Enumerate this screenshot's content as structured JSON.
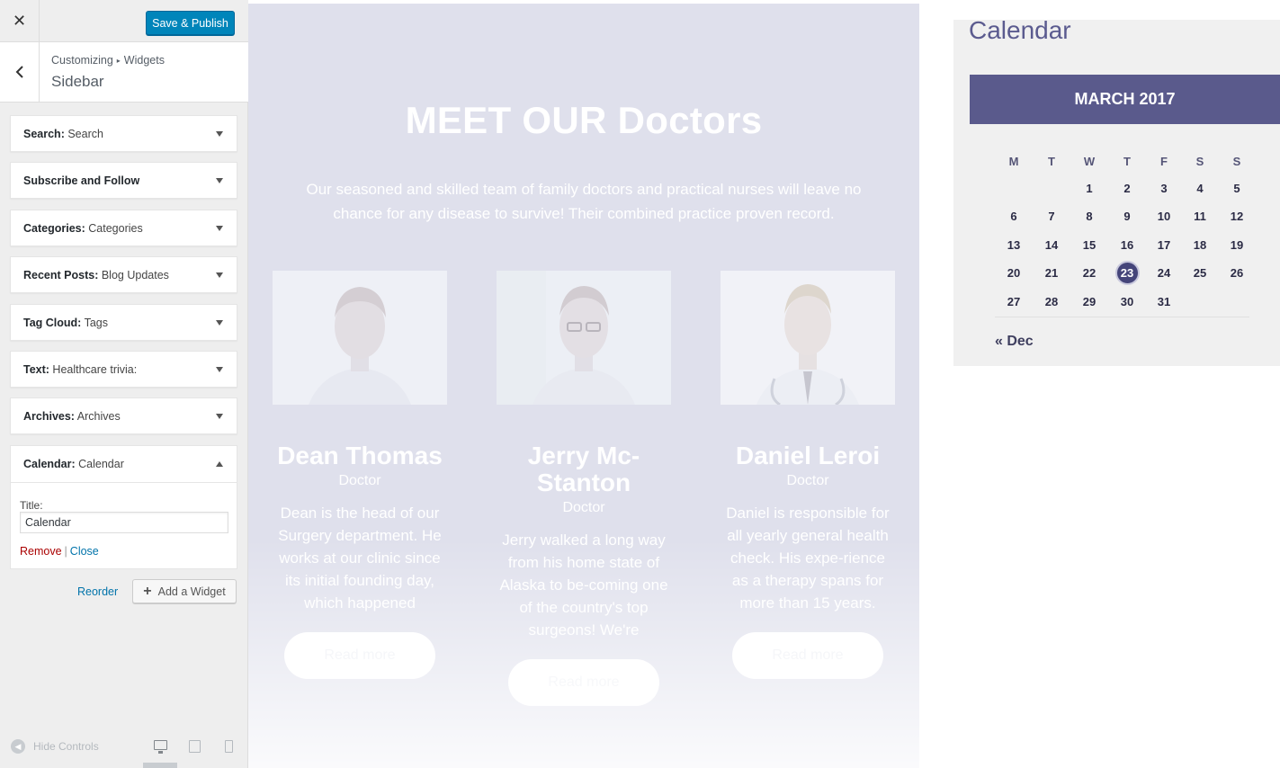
{
  "customizer": {
    "close_glyph": "✕",
    "publish_label": "Save & Publish",
    "breadcrumb": {
      "root": "Customizing",
      "separator": "▸",
      "current": "Widgets"
    },
    "section_title": "Sidebar",
    "widgets": [
      {
        "name": "Search:",
        "sub": "Search"
      },
      {
        "name": "Subscribe and Follow",
        "sub": ""
      },
      {
        "name": "Categories:",
        "sub": "Categories"
      },
      {
        "name": "Recent Posts:",
        "sub": "Blog Updates"
      },
      {
        "name": "Tag Cloud:",
        "sub": "Tags"
      },
      {
        "name": "Text:",
        "sub": "Healthcare trivia:"
      },
      {
        "name": "Archives:",
        "sub": "Archives"
      }
    ],
    "open_widget": {
      "name": "Calendar:",
      "sub": "Calendar",
      "title_label": "Title:",
      "title_value": "Calendar",
      "remove_label": "Remove",
      "separator": "|",
      "close_label": "Close"
    },
    "reorder_label": "Reorder",
    "add_widget_label": "Add a Widget",
    "add_widget_icon": "+",
    "hide_controls_label": "Hide Controls",
    "devices": [
      "desktop-icon",
      "tablet-icon",
      "mobile-icon"
    ]
  },
  "preview": {
    "headline": "MEET OUR Doctors",
    "intro_line1": "Our seasoned and skilled team of family doctors and practical nurses will leave no",
    "intro_line2": "chance for any disease to survive! Their combined practice proven record.",
    "doctors": [
      {
        "name": "Dean Thomas",
        "role": "Doctor",
        "bio": "Dean is the head of our Surgery department. He works at our clinic since its initial founding day, which happened",
        "button": "Read more"
      },
      {
        "name": "Jerry Mc-Stanton",
        "role": "Doctor",
        "bio": "Jerry walked a long way from his home state of Alaska to be-coming one of the country's top surgeons! We're",
        "button": "Read more"
      },
      {
        "name": "Daniel Leroi",
        "role": "Doctor",
        "bio": "Daniel is responsible for all yearly general health check. His expe-rience as a therapy spans for more than 15 years.",
        "button": "Read more"
      }
    ]
  },
  "calendar": {
    "title": "Calendar",
    "month": "MARCH 2017",
    "weekdays": [
      "M",
      "T",
      "W",
      "T",
      "F",
      "S",
      "S"
    ],
    "weeks": [
      [
        "",
        "",
        "1",
        "2",
        "3",
        "4",
        "5"
      ],
      [
        "6",
        "7",
        "8",
        "9",
        "10",
        "11",
        "12"
      ],
      [
        "13",
        "14",
        "15",
        "16",
        "17",
        "18",
        "19"
      ],
      [
        "20",
        "21",
        "22",
        "23",
        "24",
        "25",
        "26"
      ],
      [
        "27",
        "28",
        "29",
        "30",
        "31",
        "",
        ""
      ]
    ],
    "today": "23",
    "prev_link": "« Dec"
  },
  "colors": {
    "publish_blue": "#0085ba",
    "calendar_header": "#5a5a8c",
    "calendar_today": "#45457a",
    "link_blue": "#0073aa",
    "remove_red": "#aa0000"
  }
}
